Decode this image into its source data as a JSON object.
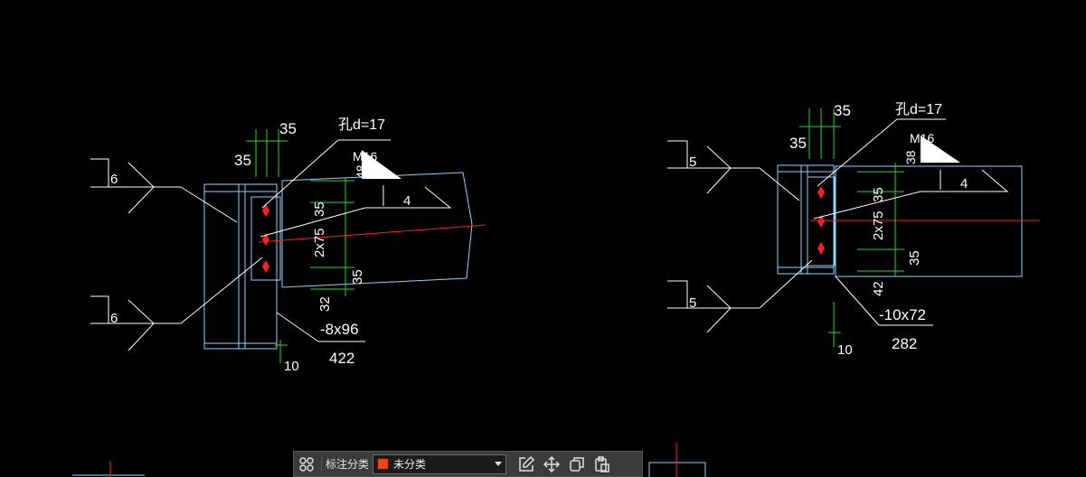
{
  "drawing": {
    "left_detail": {
      "dim_35_top": "35",
      "dim_35_left": "35",
      "hole_note": "孔d=17",
      "bolt_note": "M16",
      "dim_48": "48",
      "weld_6_top": "6",
      "weld_6_bottom": "6",
      "weld_4": "4",
      "dim_35_a": "35",
      "dim_2x75": "2x75",
      "dim_35_b": "35",
      "dim_32": "32",
      "plate_note": "-8x96",
      "plate_length": "422",
      "dim_10": "10"
    },
    "right_detail": {
      "dim_35_top": "35",
      "dim_35_left": "35",
      "hole_note": "孔d=17",
      "bolt_note": "M16",
      "dim_38": "38",
      "weld_5_top": "5",
      "weld_5_bottom": "5",
      "weld_4": "4",
      "dim_35_a": "35",
      "dim_2x75": "2x75",
      "dim_35_b": "35",
      "dim_42": "42",
      "plate_note": "-10x72",
      "plate_length": "282",
      "dim_10": "10"
    }
  },
  "toolbar": {
    "category_label": "标注分类",
    "category_value": "未分类",
    "category_color": "#e8490f",
    "icons": [
      "grid-select-icon",
      "edit-icon",
      "move-icon",
      "copy-icon",
      "paste-icon"
    ]
  },
  "colors": {
    "outline": "#8fd3ff",
    "dimension": "#27d827",
    "bolt": "#ff2020",
    "text": "#ffffff"
  }
}
